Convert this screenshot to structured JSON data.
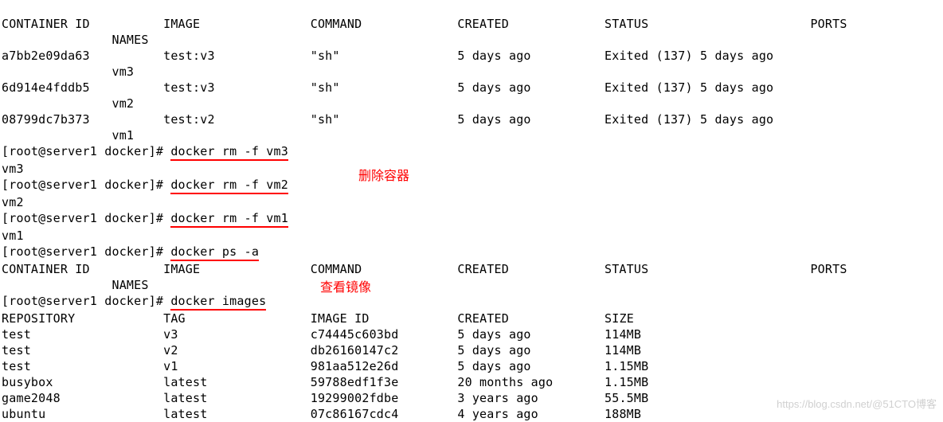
{
  "prompt": "[root@server1 docker]# ",
  "ps_header": {
    "container_id": "CONTAINER ID",
    "image": "IMAGE",
    "command": "COMMAND",
    "created": "CREATED",
    "status": "STATUS",
    "ports": "PORTS",
    "names": "NAMES"
  },
  "containers": [
    {
      "id": "a7bb2e09da63",
      "image": "test:v3",
      "command": "\"sh\"",
      "created": "5 days ago",
      "status": "Exited (137) 5 days ago",
      "names": "vm3"
    },
    {
      "id": "6d914e4fddb5",
      "image": "test:v3",
      "command": "\"sh\"",
      "created": "5 days ago",
      "status": "Exited (137) 5 days ago",
      "names": "vm2"
    },
    {
      "id": "08799dc7b373",
      "image": "test:v2",
      "command": "\"sh\"",
      "created": "5 days ago",
      "status": "Exited (137) 5 days ago",
      "names": "vm1"
    }
  ],
  "commands": {
    "rm_vm3": "docker rm -f vm3",
    "rm_vm2": "docker rm -f vm2",
    "rm_vm1": "docker rm -f vm1",
    "ps_a": "docker ps -a",
    "images": "docker images"
  },
  "outputs": {
    "rm_vm3": "vm3",
    "rm_vm2": "vm2",
    "rm_vm1": "vm1"
  },
  "images_header": {
    "repository": "REPOSITORY",
    "tag": "TAG",
    "image_id": "IMAGE ID",
    "created": "CREATED",
    "size": "SIZE"
  },
  "images": [
    {
      "repository": "test",
      "tag": "v3",
      "image_id": "c74445c603bd",
      "created": "5 days ago",
      "size": "114MB"
    },
    {
      "repository": "test",
      "tag": "v2",
      "image_id": "db26160147c2",
      "created": "5 days ago",
      "size": "114MB"
    },
    {
      "repository": "test",
      "tag": "v1",
      "image_id": "981aa512e26d",
      "created": "5 days ago",
      "size": "1.15MB"
    },
    {
      "repository": "busybox",
      "tag": "latest",
      "image_id": "59788edf1f3e",
      "created": "20 months ago",
      "size": "1.15MB"
    },
    {
      "repository": "game2048",
      "tag": "latest",
      "image_id": "19299002fdbe",
      "created": "3 years ago",
      "size": "55.5MB"
    },
    {
      "repository": "ubuntu",
      "tag": "latest",
      "image_id": "07c86167cdc4",
      "created": "4 years ago",
      "size": "188MB"
    }
  ],
  "annotations": {
    "delete_containers": "删除容器",
    "view_images": "查看镜像"
  },
  "watermark": "https://blog.csdn.net/@51CTO博客"
}
